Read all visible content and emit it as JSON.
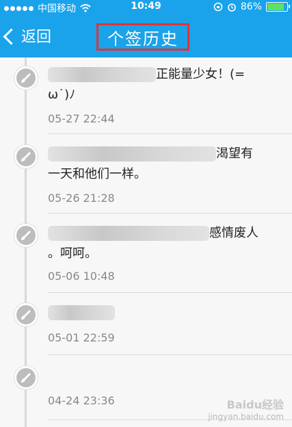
{
  "status_bar": {
    "carrier": "中国移动",
    "time": "10:49",
    "battery": "86%",
    "battery_level": 0.86
  },
  "nav": {
    "back_label": "返回",
    "title": "个签历史"
  },
  "entries": [
    {
      "line1_suffix": "正能量少女！(=",
      "line2": "ω˙)ﾉ",
      "time": "05-27 22:44"
    },
    {
      "line1_suffix": "渴望有",
      "line2": "一天和他们一样。",
      "time": "05-26 21:28"
    },
    {
      "line1_suffix": "感情废人",
      "line2": "。呵呵。",
      "time": "05-06 10:48"
    },
    {
      "line1_suffix": "",
      "line2": "",
      "time": "05-01 22:59"
    },
    {
      "line1_suffix": "",
      "line2": "",
      "time": "04-24 23:36"
    }
  ],
  "watermark": {
    "logo": "Baidu经验",
    "sub": "jingyan.baidu.com"
  },
  "colors": {
    "accent": "#1aa3ea",
    "title_box": "#e23333"
  },
  "icons": [
    "wifi-icon",
    "alarm-icon",
    "brush-icon",
    "chevron-left-icon"
  ]
}
